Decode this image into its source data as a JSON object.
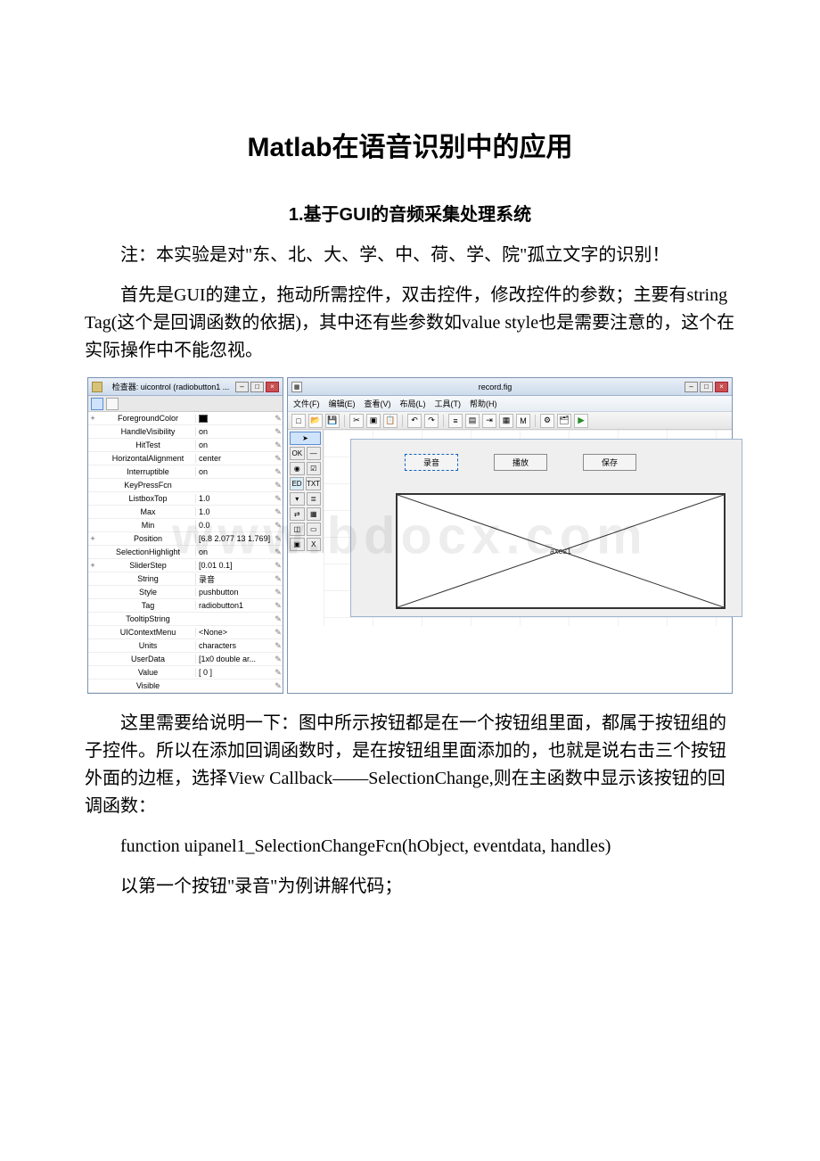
{
  "doc": {
    "title": "Matlab在语音识别中的应用",
    "section1_heading": "1.基于GUI的音频采集处理系统",
    "para1": "注：本实验是对\"东、北、大、学、中、荷、学、院\"孤立文字的识别！",
    "para2": "首先是GUI的建立，拖动所需控件，双击控件，修改控件的参数；主要有string Tag(这个是回调函数的依据)，其中还有些参数如value style也是需要注意的，这个在实际操作中不能忽视。",
    "para3": "这里需要给说明一下：图中所示按钮都是在一个按钮组里面，都属于按钮组的子控件。所以在添加回调函数时，是在按钮组里面添加的，也就是说右击三个按钮外面的边框，选择View Callback——SelectionChange,则在主函数中显示该按钮的回调函数：",
    "code_line": "function uipanel1_SelectionChangeFcn(hObject, eventdata, handles)",
    "para4": "以第一个按钮\"录音\"为例讲解代码；"
  },
  "inspector": {
    "title": "检查器: uicontrol (radiobutton1 ...",
    "props": [
      {
        "name": "ForegroundColor",
        "value": "",
        "swatch": true,
        "exp": "+"
      },
      {
        "name": "HandleVisibility",
        "value": "on"
      },
      {
        "name": "HitTest",
        "value": "on"
      },
      {
        "name": "HorizontalAlignment",
        "value": "center"
      },
      {
        "name": "Interruptible",
        "value": "on"
      },
      {
        "name": "KeyPressFcn",
        "value": ""
      },
      {
        "name": "ListboxTop",
        "value": "1.0"
      },
      {
        "name": "Max",
        "value": "1.0"
      },
      {
        "name": "Min",
        "value": "0.0"
      },
      {
        "name": "Position",
        "value": "[6.8 2.077 13 1.769]",
        "exp": "+"
      },
      {
        "name": "SelectionHighlight",
        "value": "on"
      },
      {
        "name": "SliderStep",
        "value": "[0.01 0.1]",
        "exp": "+"
      },
      {
        "name": "String",
        "value": "录音"
      },
      {
        "name": "Style",
        "value": "pushbutton"
      },
      {
        "name": "Tag",
        "value": "radiobutton1"
      },
      {
        "name": "TooltipString",
        "value": ""
      },
      {
        "name": "UIContextMenu",
        "value": "<None>"
      },
      {
        "name": "Units",
        "value": "characters"
      },
      {
        "name": "UserData",
        "value": "[1x0  double ar..."
      },
      {
        "name": "Value",
        "value": "[ 0 ]"
      },
      {
        "name": "Visible",
        "value": ""
      }
    ]
  },
  "guide": {
    "title_icon": "record.fig",
    "menu": [
      "文件(F)",
      "编辑(E)",
      "查看(V)",
      "布局(L)",
      "工具(T)",
      "帮助(H)"
    ],
    "buttons": {
      "record": "录音",
      "play": "播放",
      "save": "保存"
    },
    "axes_label": "axes1"
  },
  "watermark": "www.bdocx.com"
}
